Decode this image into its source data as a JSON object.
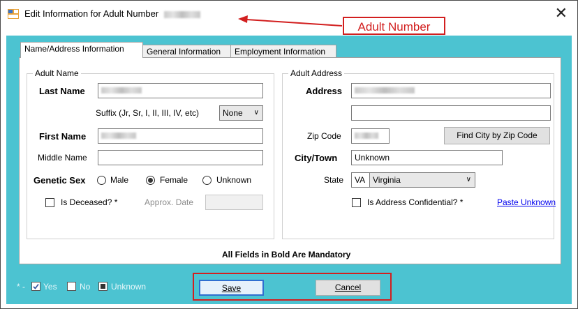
{
  "window": {
    "title": "Edit Information for Adult Number",
    "close_glyph": "✕"
  },
  "annotation": {
    "callout_label": "Adult Number",
    "color": "#d21f1f"
  },
  "tabs": [
    {
      "label": "Name/Address Information",
      "active": true
    },
    {
      "label": "General Information",
      "active": false
    },
    {
      "label": "Employment Information",
      "active": false
    }
  ],
  "adult_name": {
    "legend": "Adult Name",
    "last_name_label": "Last Name",
    "suffix_label": "Suffix (Jr, Sr, I, II, III, IV, etc)",
    "suffix_value": "None",
    "first_name_label": "First Name",
    "middle_name_label": "Middle Name",
    "middle_name_value": "",
    "genetic_sex_label": "Genetic Sex",
    "sex_options": [
      "Male",
      "Female",
      "Unknown"
    ],
    "sex_selected": "Female",
    "deceased_label": "Is Deceased? *",
    "approx_date_label": "Approx. Date"
  },
  "adult_address": {
    "legend": "Adult Address",
    "address_label": "Address",
    "address_line2": "",
    "zip_label": "Zip Code",
    "find_city_button": "Find City by Zip Code",
    "city_label": "City/Town",
    "city_value": "Unknown",
    "state_label": "State",
    "state_code": "VA",
    "state_name": "Virginia",
    "confidential_label": "Is Address Confidential? *",
    "paste_unknown_link": "Paste Unknown"
  },
  "mandatory_note": "All Fields in Bold Are Mandatory",
  "legend": {
    "prefix": "* -",
    "yes": "Yes",
    "no": "No",
    "unknown": "Unknown"
  },
  "buttons": {
    "save": "Save",
    "cancel": "Cancel"
  },
  "colors": {
    "teal_background": "#4cc3d1",
    "annotation_red": "#d21f1f",
    "link_blue": "#0000ee"
  }
}
